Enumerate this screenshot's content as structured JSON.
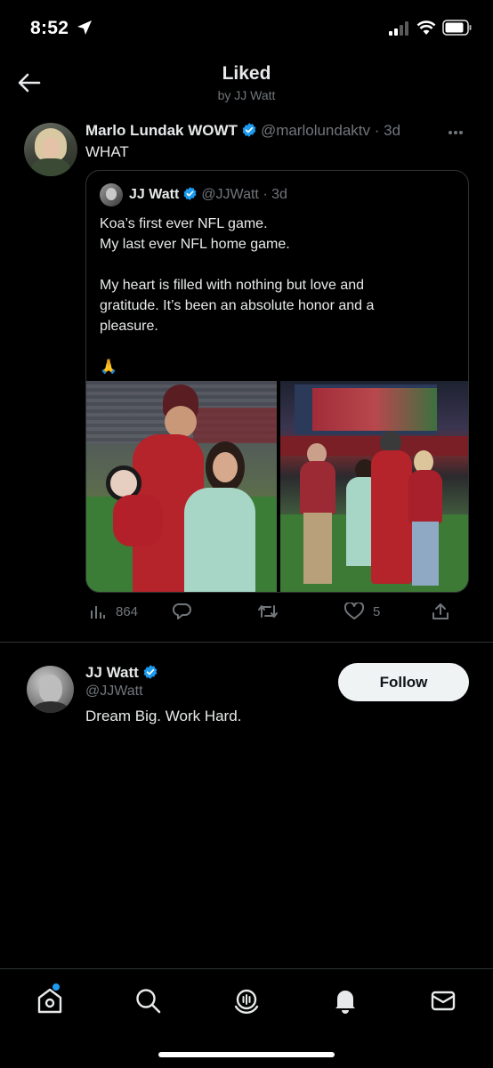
{
  "status_bar": {
    "time": "8:52",
    "icons": [
      "location-arrow-icon",
      "signal-icon",
      "wifi-icon",
      "battery-icon"
    ]
  },
  "header": {
    "title": "Liked",
    "subtitle": "by JJ Watt",
    "back_icon": "arrow-left-icon"
  },
  "tweet": {
    "author_name": "Marlo Lundak WOWT",
    "author_handle": "@marlolundaktv",
    "separator": "·",
    "time": "3d",
    "text": "WHAT",
    "more_icon": "more-dots-icon",
    "quote": {
      "author_name": "JJ Watt",
      "author_handle": "@JJWatt",
      "separator": "·",
      "time": "3d",
      "lines": [
        "Koa’s first ever NFL game.",
        "My last ever NFL home game.",
        "",
        "My heart is filled with nothing but love and",
        "gratitude. It’s been an absolute honor and a",
        "pleasure.",
        "",
        "🙏"
      ],
      "media_count": 2
    },
    "actions": {
      "views": "864",
      "replies": "",
      "retweets": "",
      "likes": "5"
    }
  },
  "profile_card": {
    "name": "JJ Watt",
    "handle": "@JJWatt",
    "bio": "Dream Big. Work Hard.",
    "follow_label": "Follow"
  },
  "bottom_nav": {
    "items": [
      "home-icon",
      "search-icon",
      "spaces-icon",
      "notifications-icon",
      "messages-icon"
    ],
    "home_has_dot": true
  },
  "colors": {
    "background": "#000000",
    "text": "#e7e9ea",
    "muted": "#71767b",
    "border": "#2f3336",
    "accent": "#1d9bf0",
    "like": "#71767b"
  }
}
